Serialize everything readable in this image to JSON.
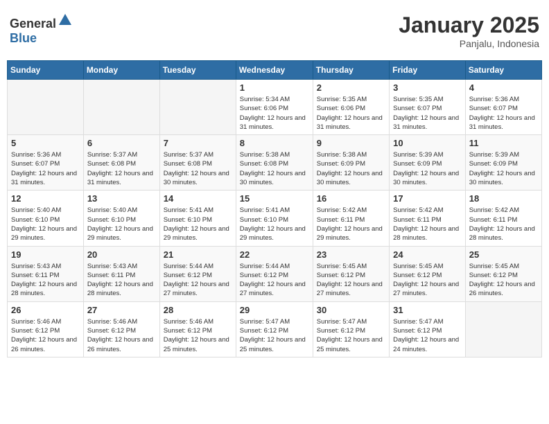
{
  "header": {
    "logo_general": "General",
    "logo_blue": "Blue",
    "title": "January 2025",
    "location": "Panjalu, Indonesia"
  },
  "weekdays": [
    "Sunday",
    "Monday",
    "Tuesday",
    "Wednesday",
    "Thursday",
    "Friday",
    "Saturday"
  ],
  "weeks": [
    [
      {
        "day": "",
        "info": ""
      },
      {
        "day": "",
        "info": ""
      },
      {
        "day": "",
        "info": ""
      },
      {
        "day": "1",
        "info": "Sunrise: 5:34 AM\nSunset: 6:06 PM\nDaylight: 12 hours and 31 minutes."
      },
      {
        "day": "2",
        "info": "Sunrise: 5:35 AM\nSunset: 6:06 PM\nDaylight: 12 hours and 31 minutes."
      },
      {
        "day": "3",
        "info": "Sunrise: 5:35 AM\nSunset: 6:07 PM\nDaylight: 12 hours and 31 minutes."
      },
      {
        "day": "4",
        "info": "Sunrise: 5:36 AM\nSunset: 6:07 PM\nDaylight: 12 hours and 31 minutes."
      }
    ],
    [
      {
        "day": "5",
        "info": "Sunrise: 5:36 AM\nSunset: 6:07 PM\nDaylight: 12 hours and 31 minutes."
      },
      {
        "day": "6",
        "info": "Sunrise: 5:37 AM\nSunset: 6:08 PM\nDaylight: 12 hours and 31 minutes."
      },
      {
        "day": "7",
        "info": "Sunrise: 5:37 AM\nSunset: 6:08 PM\nDaylight: 12 hours and 30 minutes."
      },
      {
        "day": "8",
        "info": "Sunrise: 5:38 AM\nSunset: 6:08 PM\nDaylight: 12 hours and 30 minutes."
      },
      {
        "day": "9",
        "info": "Sunrise: 5:38 AM\nSunset: 6:09 PM\nDaylight: 12 hours and 30 minutes."
      },
      {
        "day": "10",
        "info": "Sunrise: 5:39 AM\nSunset: 6:09 PM\nDaylight: 12 hours and 30 minutes."
      },
      {
        "day": "11",
        "info": "Sunrise: 5:39 AM\nSunset: 6:09 PM\nDaylight: 12 hours and 30 minutes."
      }
    ],
    [
      {
        "day": "12",
        "info": "Sunrise: 5:40 AM\nSunset: 6:10 PM\nDaylight: 12 hours and 29 minutes."
      },
      {
        "day": "13",
        "info": "Sunrise: 5:40 AM\nSunset: 6:10 PM\nDaylight: 12 hours and 29 minutes."
      },
      {
        "day": "14",
        "info": "Sunrise: 5:41 AM\nSunset: 6:10 PM\nDaylight: 12 hours and 29 minutes."
      },
      {
        "day": "15",
        "info": "Sunrise: 5:41 AM\nSunset: 6:10 PM\nDaylight: 12 hours and 29 minutes."
      },
      {
        "day": "16",
        "info": "Sunrise: 5:42 AM\nSunset: 6:11 PM\nDaylight: 12 hours and 29 minutes."
      },
      {
        "day": "17",
        "info": "Sunrise: 5:42 AM\nSunset: 6:11 PM\nDaylight: 12 hours and 28 minutes."
      },
      {
        "day": "18",
        "info": "Sunrise: 5:42 AM\nSunset: 6:11 PM\nDaylight: 12 hours and 28 minutes."
      }
    ],
    [
      {
        "day": "19",
        "info": "Sunrise: 5:43 AM\nSunset: 6:11 PM\nDaylight: 12 hours and 28 minutes."
      },
      {
        "day": "20",
        "info": "Sunrise: 5:43 AM\nSunset: 6:11 PM\nDaylight: 12 hours and 28 minutes."
      },
      {
        "day": "21",
        "info": "Sunrise: 5:44 AM\nSunset: 6:12 PM\nDaylight: 12 hours and 27 minutes."
      },
      {
        "day": "22",
        "info": "Sunrise: 5:44 AM\nSunset: 6:12 PM\nDaylight: 12 hours and 27 minutes."
      },
      {
        "day": "23",
        "info": "Sunrise: 5:45 AM\nSunset: 6:12 PM\nDaylight: 12 hours and 27 minutes."
      },
      {
        "day": "24",
        "info": "Sunrise: 5:45 AM\nSunset: 6:12 PM\nDaylight: 12 hours and 27 minutes."
      },
      {
        "day": "25",
        "info": "Sunrise: 5:45 AM\nSunset: 6:12 PM\nDaylight: 12 hours and 26 minutes."
      }
    ],
    [
      {
        "day": "26",
        "info": "Sunrise: 5:46 AM\nSunset: 6:12 PM\nDaylight: 12 hours and 26 minutes."
      },
      {
        "day": "27",
        "info": "Sunrise: 5:46 AM\nSunset: 6:12 PM\nDaylight: 12 hours and 26 minutes."
      },
      {
        "day": "28",
        "info": "Sunrise: 5:46 AM\nSunset: 6:12 PM\nDaylight: 12 hours and 25 minutes."
      },
      {
        "day": "29",
        "info": "Sunrise: 5:47 AM\nSunset: 6:12 PM\nDaylight: 12 hours and 25 minutes."
      },
      {
        "day": "30",
        "info": "Sunrise: 5:47 AM\nSunset: 6:12 PM\nDaylight: 12 hours and 25 minutes."
      },
      {
        "day": "31",
        "info": "Sunrise: 5:47 AM\nSunset: 6:12 PM\nDaylight: 12 hours and 24 minutes."
      },
      {
        "day": "",
        "info": ""
      }
    ]
  ]
}
